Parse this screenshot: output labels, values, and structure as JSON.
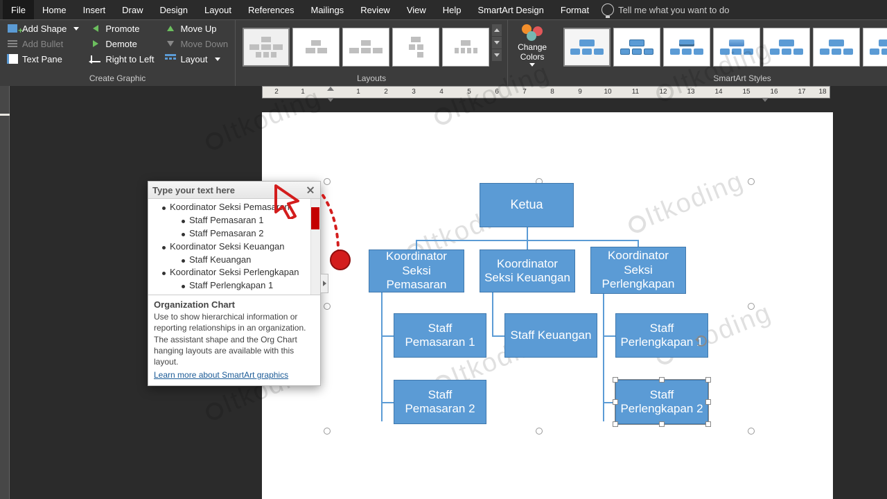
{
  "tabs": [
    "File",
    "Home",
    "Insert",
    "Draw",
    "Design",
    "Layout",
    "References",
    "Mailings",
    "Review",
    "View",
    "Help",
    "SmartArt Design",
    "Format"
  ],
  "search_hint": "Tell me what you want to do",
  "ribbon": {
    "create_graphic": {
      "label": "Create Graphic",
      "add_shape": "Add Shape",
      "add_bullet": "Add Bullet",
      "text_pane": "Text Pane",
      "promote": "Promote",
      "demote": "Demote",
      "right_to_left": "Right to Left",
      "move_up": "Move Up",
      "move_down": "Move Down",
      "layout": "Layout"
    },
    "layouts_label": "Layouts",
    "change_colors": "Change Colors",
    "styles_label": "SmartArt Styles"
  },
  "ruler_numbers": [
    "2",
    "1",
    "",
    "1",
    "2",
    "3",
    "4",
    "5",
    "6",
    "7",
    "8",
    "9",
    "10",
    "11",
    "12",
    "13",
    "14",
    "15",
    "16",
    "17",
    "18"
  ],
  "textpane": {
    "title": "Type your text here",
    "items": [
      {
        "level": 1,
        "text": "Koordinator Seksi Pemasaran"
      },
      {
        "level": 2,
        "text": "Staff Pemasaran 1"
      },
      {
        "level": 2,
        "text": "Staff Pemasaran 2"
      },
      {
        "level": 1,
        "text": "Koordinator Seksi Keuangan"
      },
      {
        "level": 2,
        "text": "Staff Keuangan"
      },
      {
        "level": 1,
        "text": "Koordinator Seksi Perlengkapan"
      },
      {
        "level": 2,
        "text": "Staff Perlengkapan 1"
      }
    ],
    "footer_title": "Organization Chart",
    "footer_desc": "Use to show hierarchical information or reporting relationships in an organization. The assistant shape and the Org Chart hanging layouts are available with this layout.",
    "footer_link": "Learn more about SmartArt graphics"
  },
  "chart_data": {
    "type": "org-chart",
    "root": "Ketua",
    "nodes": [
      {
        "id": "ketua",
        "label": "Ketua"
      },
      {
        "id": "ksp",
        "label": "Koordinator Seksi Pemasaran"
      },
      {
        "id": "ksk",
        "label": "Koordinator Seksi Keuangan"
      },
      {
        "id": "ksl",
        "label": "Koordinator Seksi Perlengkapan"
      },
      {
        "id": "sp1",
        "label": "Staff Pemasaran 1"
      },
      {
        "id": "sp2",
        "label": "Staff Pemasaran 2"
      },
      {
        "id": "sk",
        "label": "Staff Keuangan"
      },
      {
        "id": "sl1",
        "label": "Staff Perlengkapan 1"
      },
      {
        "id": "sl2",
        "label": "Staff Perlengkapan 2"
      }
    ],
    "edges": [
      [
        "ketua",
        "ksp"
      ],
      [
        "ketua",
        "ksk"
      ],
      [
        "ketua",
        "ksl"
      ],
      [
        "ksp",
        "sp1"
      ],
      [
        "ksp",
        "sp2"
      ],
      [
        "ksk",
        "sk"
      ],
      [
        "ksl",
        "sl1"
      ],
      [
        "ksl",
        "sl2"
      ]
    ]
  },
  "watermark": "Itkoding"
}
